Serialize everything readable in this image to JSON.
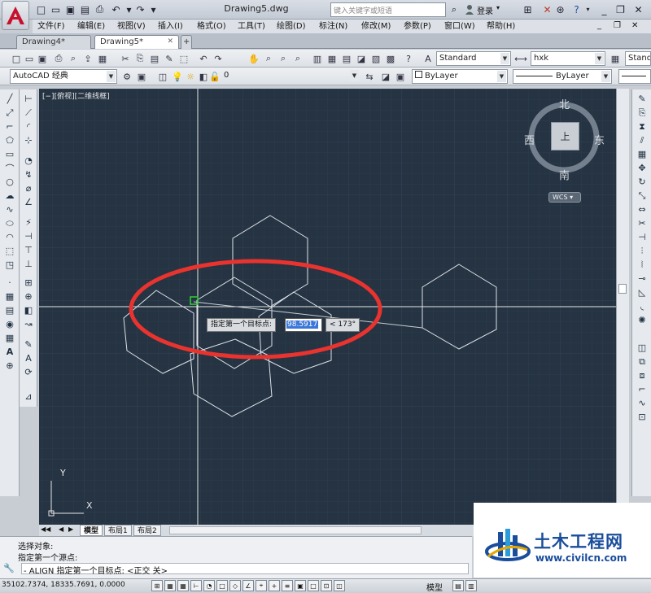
{
  "title": {
    "document": "Drawing5.dwg",
    "search_placeholder": "键入关键字或短语",
    "login": "登录"
  },
  "menus": [
    "文件(F)",
    "编辑(E)",
    "视图(V)",
    "插入(I)",
    "格式(O)",
    "工具(T)",
    "绘图(D)",
    "标注(N)",
    "修改(M)",
    "参数(P)",
    "窗口(W)",
    "帮助(H)"
  ],
  "tabs": [
    {
      "label": "Drawing4*",
      "active": false
    },
    {
      "label": "Drawing5*",
      "active": true
    }
  ],
  "toolbar": {
    "text_style": "Standard",
    "dim_style": "hxk",
    "table_style": "Stand",
    "workspace": "AutoCAD 经典",
    "layer": "0",
    "color": "ByLayer",
    "linetype": "ByLayer"
  },
  "viewport": {
    "view_label": "[−][俯视][二维线框]",
    "compass": {
      "north": "北",
      "south": "南",
      "east": "东",
      "west": "西",
      "top_face": "上"
    },
    "wcs": "WCS",
    "ucs_x": "X",
    "ucs_y": "Y"
  },
  "tooltip": {
    "prompt": "指定第一个目标点:",
    "value": "98.5917",
    "angle": "< 173°"
  },
  "layout_tabs": [
    "模型",
    "布局1",
    "布局2"
  ],
  "command": {
    "line1": "选择对象:",
    "line2": "指定第一个源点:",
    "line3": "- ALIGN 指定第一个目标点: <正交 关>"
  },
  "status": {
    "coords": "35102.7374, 18335.7691, 0.0000",
    "model": "模型"
  },
  "watermark": {
    "title": "土木工程网",
    "url": "www.civilcn.com"
  },
  "colors": {
    "canvas": "#253342",
    "grid": "#2f3e4e",
    "highlight": "#e8332f",
    "brand": "#1a4d9c"
  }
}
